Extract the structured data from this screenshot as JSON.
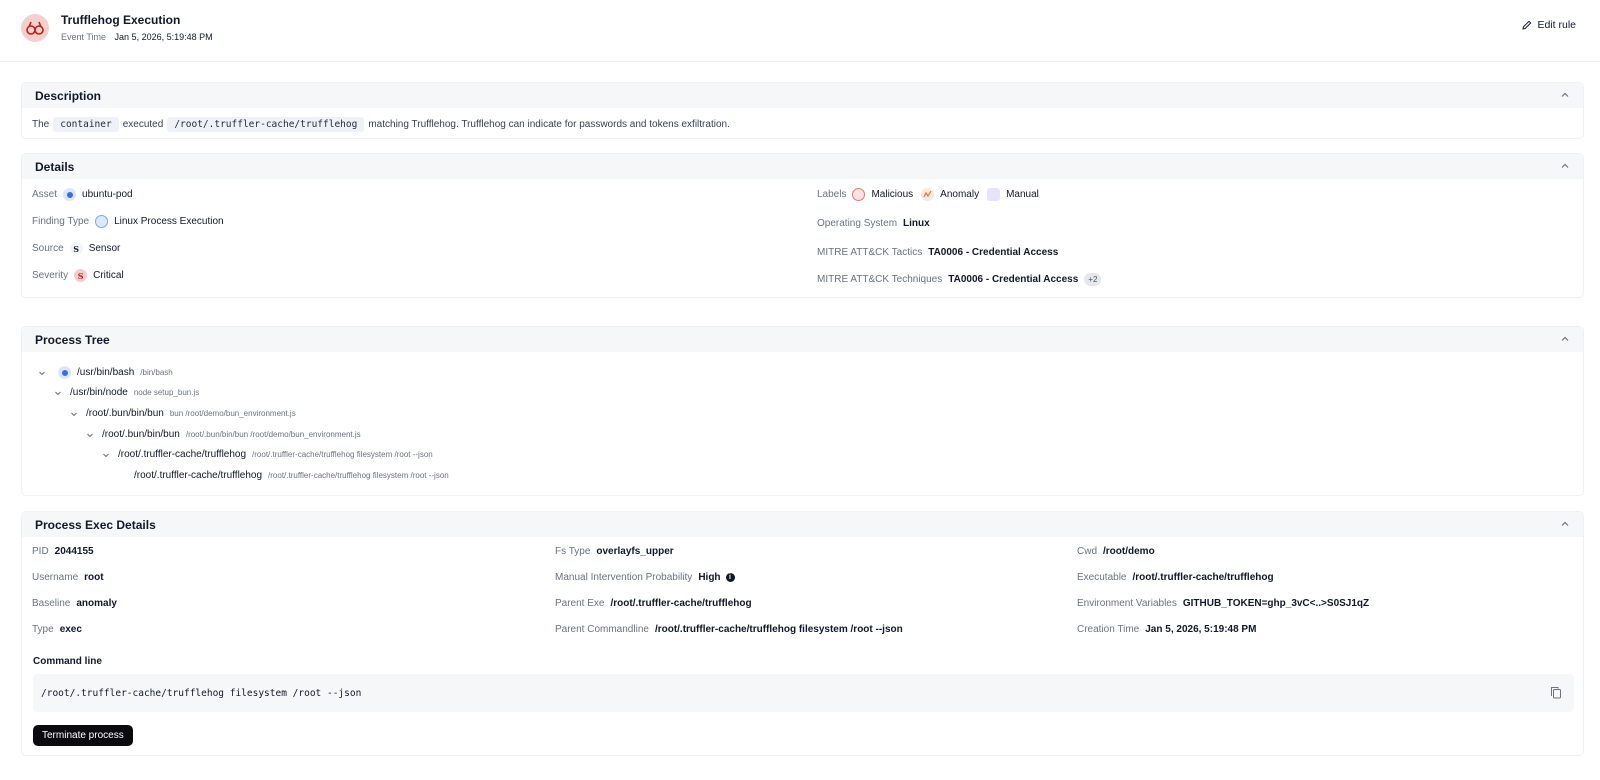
{
  "header": {
    "title": "Trufflehog Execution",
    "event_time_label": "Event Time",
    "event_time_value": "Jan 5, 2026, 5:19:48 PM",
    "edit_rule": "Edit rule"
  },
  "description": {
    "title": "Description",
    "pre": "The",
    "entity": "container",
    "verb": "executed",
    "path": "/root/.truffler-cache/trufflehog",
    "post": "matching Trufflehog. Trufflehog can indicate for passwords and tokens exfiltration."
  },
  "details": {
    "title": "Details",
    "asset_label": "Asset",
    "asset_value": "ubuntu-pod",
    "finding_type_label": "Finding Type",
    "finding_type_value": "Linux Process Execution",
    "source_label": "Source",
    "source_value": "Sensor",
    "severity_label": "Severity",
    "severity_value": "Critical",
    "labels_label": "Labels",
    "labels": [
      "Malicious",
      "Anomaly",
      "Manual"
    ],
    "os_label": "Operating System",
    "os_value": "Linux",
    "tactics_label": "MITRE ATT&CK Tactics",
    "tactics_value": "TA0006 - Credential Access",
    "techniques_label": "MITRE ATT&CK Techniques",
    "techniques_value": "TA0006 - Credential Access",
    "techniques_more": "+2"
  },
  "process_tree": {
    "title": "Process Tree",
    "nodes": [
      {
        "path": "/usr/bin/bash",
        "cmd": "/bin/bash"
      },
      {
        "path": "/usr/bin/node",
        "cmd": "node setup_bun.js"
      },
      {
        "path": "/root/.bun/bin/bun",
        "cmd": "bun /root/demo/bun_environment.js"
      },
      {
        "path": "/root/.bun/bin/bun",
        "cmd": "/root/.bun/bin/bun /root/demo/bun_environment.js"
      },
      {
        "path": "/root/.truffler-cache/trufflehog",
        "cmd": "/root/.truffler-cache/trufflehog filesystem /root --json"
      },
      {
        "path": "/root/.truffler-cache/trufflehog",
        "cmd": "/root/.truffler-cache/trufflehog filesystem /root --json"
      }
    ]
  },
  "exec": {
    "title": "Process Exec Details",
    "pid_label": "PID",
    "pid_value": "2044155",
    "username_label": "Username",
    "username_value": "root",
    "baseline_label": "Baseline",
    "baseline_value": "anomaly",
    "type_label": "Type",
    "type_value": "exec",
    "fs_type_label": "Fs Type",
    "fs_type_value": "overlayfs_upper",
    "mip_label": "Manual Intervention Probability",
    "mip_value": "High",
    "parent_exe_label": "Parent Exe",
    "parent_exe_value": "/root/.truffler-cache/trufflehog",
    "parent_cmd_label": "Parent Commandline",
    "parent_cmd_value": "/root/.truffler-cache/trufflehog filesystem /root --json",
    "cwd_label": "Cwd",
    "cwd_value": "/root/demo",
    "executable_label": "Executable",
    "executable_value": "/root/.truffler-cache/trufflehog",
    "env_label": "Environment Variables",
    "env_value": "GITHUB_TOKEN=ghp_3vC<..>S0SJ1qZ",
    "creation_label": "Creation Time",
    "creation_value": "Jan 5, 2026, 5:19:48 PM",
    "command_line_label": "Command line",
    "command_line_value": "/root/.truffler-cache/trufflehog filesystem /root --json",
    "terminate_label": "Terminate process"
  }
}
